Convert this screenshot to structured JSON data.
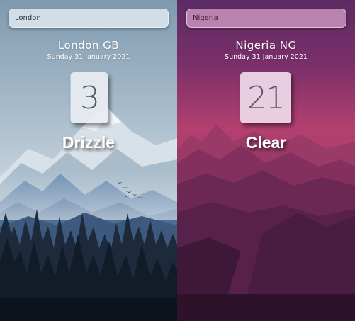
{
  "panels": [
    {
      "search_value": "London",
      "city": "London GB",
      "date": "Sunday 31 January 2021",
      "temperature": "3",
      "condition": "Drizzle",
      "theme": "blue-mountains"
    },
    {
      "search_value": "Nigeria",
      "city": "Nigeria NG",
      "date": "Sunday 31 January 2021",
      "temperature": "21",
      "condition": "Clear",
      "theme": "magenta-mountains"
    }
  ],
  "colors": {
    "left_sky_top": "#7f9ab0",
    "left_sky_bottom": "#c3d2dc",
    "right_sky_top": "#5c2b63",
    "right_sky_bottom": "#b3406f"
  }
}
